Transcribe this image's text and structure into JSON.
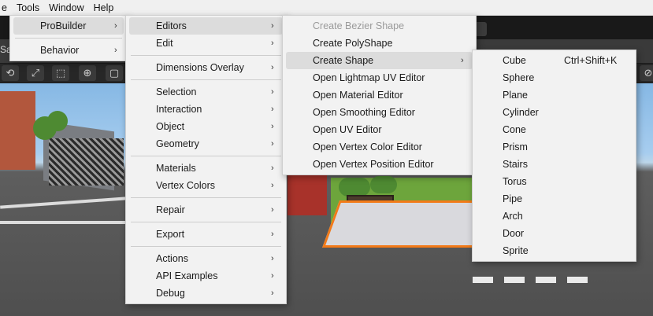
{
  "menubar": {
    "items": [
      "e",
      "Tools",
      "Window",
      "Help"
    ]
  },
  "scene": {
    "left_label": "Sa"
  },
  "menu_probuilder_root": {
    "items": [
      {
        "label": "ProBuilder",
        "submenu": true,
        "highlighted": true
      },
      {
        "label": "Behavior",
        "submenu": true
      }
    ]
  },
  "menu_probuilder": {
    "groups": [
      [
        {
          "label": "Editors",
          "submenu": true,
          "highlighted": true
        },
        {
          "label": "Edit",
          "submenu": true
        }
      ],
      [
        {
          "label": "Dimensions Overlay",
          "submenu": true
        }
      ],
      [
        {
          "label": "Selection",
          "submenu": true
        },
        {
          "label": "Interaction",
          "submenu": true
        },
        {
          "label": "Object",
          "submenu": true
        },
        {
          "label": "Geometry",
          "submenu": true
        }
      ],
      [
        {
          "label": "Materials",
          "submenu": true
        },
        {
          "label": "Vertex Colors",
          "submenu": true
        }
      ],
      [
        {
          "label": "Repair",
          "submenu": true
        }
      ],
      [
        {
          "label": "Export",
          "submenu": true
        }
      ],
      [
        {
          "label": "Actions",
          "submenu": true
        },
        {
          "label": "API Examples",
          "submenu": true
        },
        {
          "label": "Debug",
          "submenu": true
        }
      ]
    ]
  },
  "menu_editors": {
    "items": [
      {
        "label": "Create Bezier Shape",
        "disabled": true
      },
      {
        "label": "Create PolyShape"
      },
      {
        "label": "Create Shape",
        "submenu": true,
        "highlighted": true
      },
      {
        "label": "Open Lightmap UV Editor"
      },
      {
        "label": "Open Material Editor"
      },
      {
        "label": "Open Smoothing Editor"
      },
      {
        "label": "Open UV Editor"
      },
      {
        "label": "Open Vertex Color Editor"
      },
      {
        "label": "Open Vertex Position Editor"
      }
    ]
  },
  "menu_create_shape": {
    "items": [
      {
        "label": "Cube",
        "shortcut": "Ctrl+Shift+K"
      },
      {
        "label": "Sphere"
      },
      {
        "label": "Plane"
      },
      {
        "label": "Cylinder"
      },
      {
        "label": "Cone"
      },
      {
        "label": "Prism"
      },
      {
        "label": "Stairs"
      },
      {
        "label": "Torus"
      },
      {
        "label": "Pipe"
      },
      {
        "label": "Arch"
      },
      {
        "label": "Door"
      },
      {
        "label": "Sprite"
      }
    ]
  },
  "icons": {
    "submenu_arrow": "›",
    "chevron-right-icon": "chevron"
  }
}
